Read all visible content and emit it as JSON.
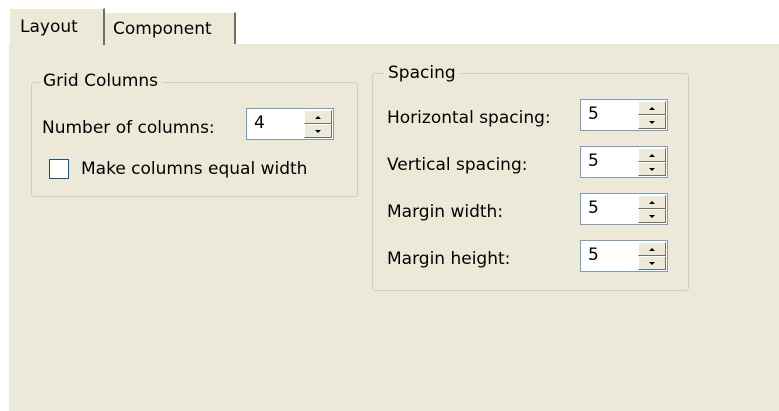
{
  "tabs": [
    {
      "label": "Layout",
      "active": true
    },
    {
      "label": "Component",
      "active": false
    }
  ],
  "grid_columns": {
    "title": "Grid Columns",
    "number_of_columns_label": "Number of columns:",
    "number_of_columns_value": "4",
    "equal_width_label": "Make columns equal width",
    "equal_width_checked": false
  },
  "spacing": {
    "title": "Spacing",
    "horizontal_label": "Horizontal spacing:",
    "horizontal_value": "5",
    "vertical_label": "Vertical spacing:",
    "vertical_value": "5",
    "margin_width_label": "Margin width:",
    "margin_width_value": "5",
    "margin_height_label": "Margin height:",
    "margin_height_value": "5"
  },
  "colors": {
    "panel_bg": "#ece9d8",
    "group_border": "#d0d0bf",
    "input_border": "#7f9db9",
    "checkbox_border": "#1c5180"
  }
}
